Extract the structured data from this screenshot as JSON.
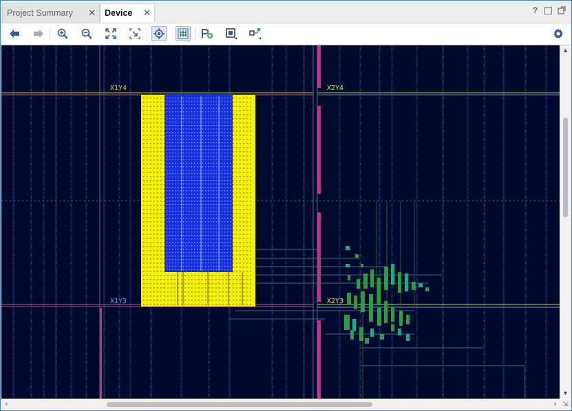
{
  "tabs": [
    {
      "label": "Project Summary",
      "active": false
    },
    {
      "label": "Device",
      "active": true
    }
  ],
  "tab_close_glyph": "✕",
  "window_controls": {
    "help": "?",
    "restore": "",
    "float": ""
  },
  "toolbar": {
    "buttons": [
      {
        "name": "back-icon",
        "pressed": false
      },
      {
        "name": "forward-icon",
        "pressed": false
      },
      {
        "name": "zoom-in-icon",
        "pressed": false
      },
      {
        "name": "zoom-out-icon",
        "pressed": false
      },
      {
        "name": "zoom-fit-icon",
        "pressed": false
      },
      {
        "name": "zoom-selection-icon",
        "pressed": false
      },
      {
        "name": "auto-fit-selection-icon",
        "pressed": true
      },
      {
        "name": "routing-resources-icon",
        "pressed": true
      },
      {
        "name": "add-pblock-icon",
        "pressed": false
      },
      {
        "name": "draw-pblock-icon",
        "pressed": false
      },
      {
        "name": "route-icon",
        "pressed": false
      },
      {
        "name": "settings-gear-icon",
        "pressed": false
      }
    ]
  },
  "device_view": {
    "clock_regions": [
      {
        "label": "X1Y4",
        "color": "#b8d63a"
      },
      {
        "label": "X2Y4",
        "color": "#d8e070"
      },
      {
        "label": "X1Y3",
        "color": "#7a96d8"
      },
      {
        "label": "X2Y3",
        "color": "#d8e070"
      }
    ],
    "colors": {
      "background": "#000a2e",
      "region_border_top": "#b8d63a",
      "region_border_mid": "#e04040",
      "pblock_fill": "#f4f000",
      "pblock_inner": "#1530e8",
      "placed_cells": "#2e9a46",
      "placed_cells_highlight": "#1fa88a",
      "column_highlight": "#e0208c",
      "routing": "#3a6a8a"
    }
  },
  "scrollbars": {
    "vertical_position": 0.21,
    "horizontal_position": 0.19
  }
}
